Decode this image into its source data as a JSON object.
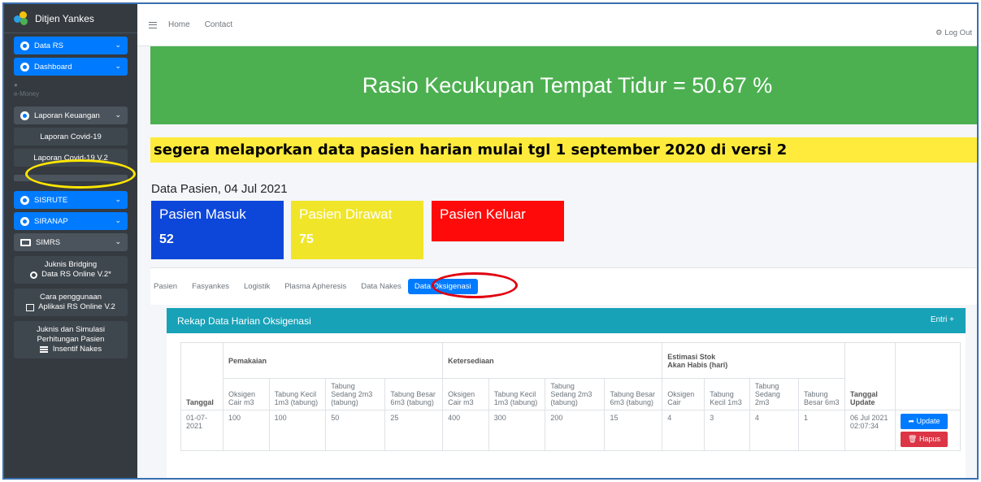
{
  "sidebar": {
    "brand": "Ditjen Yankes",
    "items": [
      {
        "label": "Data RS"
      },
      {
        "label": "Dashboard"
      },
      {
        "label": "e-Money"
      },
      {
        "label": "Laporan Keuangan"
      },
      {
        "label": "Laporan Covid-19"
      },
      {
        "label": "Laporan Covid-19 V.2"
      },
      {
        "label": "SISRUTE"
      },
      {
        "label": "SIRANAP"
      },
      {
        "label": "SIMRS"
      },
      {
        "line1": "Juknis Bridging",
        "line2": "Data RS Online V.2*"
      },
      {
        "line1": "Cara penggunaan",
        "line2": "Aplikasi RS Online V.2"
      },
      {
        "line1": "Juknis dan Simulasi",
        "line2": "Perhitungan Pasien",
        "line3": "Insentif Nakes"
      }
    ]
  },
  "topbar": {
    "home": "Home",
    "contact": "Contact",
    "logout": "Log Out"
  },
  "banner": {
    "ratio": "Rasio Kecukupan Tempat Tidur = 50.67 %",
    "notice": "segera melaporkan data pasien harian mulai tgl 1 september 2020 di versi 2"
  },
  "data_title": "Data Pasien, 04 Jul 2021",
  "boxes": {
    "masuk": {
      "label": "Pasien Masuk",
      "value": "52"
    },
    "dirawat": {
      "label": "Pasien Dirawat",
      "value": "75"
    },
    "keluar": {
      "label": "Pasien Keluar"
    }
  },
  "tabs": [
    "Pasien",
    "Fasyankes",
    "Logistik",
    "Plasma Apheresis",
    "Data Nakes",
    "Data Oksigenasi"
  ],
  "card": {
    "title": "Rekap Data Harian Oksigenasi",
    "entri": "Entri +"
  },
  "table": {
    "groups": {
      "pemakaian": "Pemakaian",
      "ketersediaan": "Ketersediaan",
      "estimasi1": "Estimasi Stok",
      "estimasi2": "Akan Habis (hari)"
    },
    "cols": {
      "tanggal": "Tanggal",
      "p1": "Oksigen Cair m3",
      "p2": "Tabung Kecil 1m3 (tabung)",
      "p3": "Tabung Sedang 2m3 (tabung)",
      "p4": "Tabung Besar 6m3 (tabung)",
      "k1": "Oksigen Cair m3",
      "k2": "Tabung Kecil 1m3 (tabung)",
      "k3": "Tabung Sedang 2m3 (tabung)",
      "k4": "Tabung Besar 6m3 (tabung)",
      "e1": "Oksigen Cair",
      "e2": "Tabung Kecil 1m3",
      "e3": "Tabung Sedang 2m3",
      "e4": "Tabung Besar 6m3",
      "update": "Tanggal Update"
    },
    "row": {
      "tanggal": "01-07-2021",
      "p1": "100",
      "p2": "100",
      "p3": "50",
      "p4": "25",
      "k1": "400",
      "k2": "300",
      "k3": "200",
      "k4": "15",
      "e1": "4",
      "e2": "3",
      "e3": "4",
      "e4": "1",
      "update": "06 Jul 2021 02:07:34"
    },
    "buttons": {
      "update": "➦ Update",
      "hapus": "🗑 Hapus"
    }
  }
}
